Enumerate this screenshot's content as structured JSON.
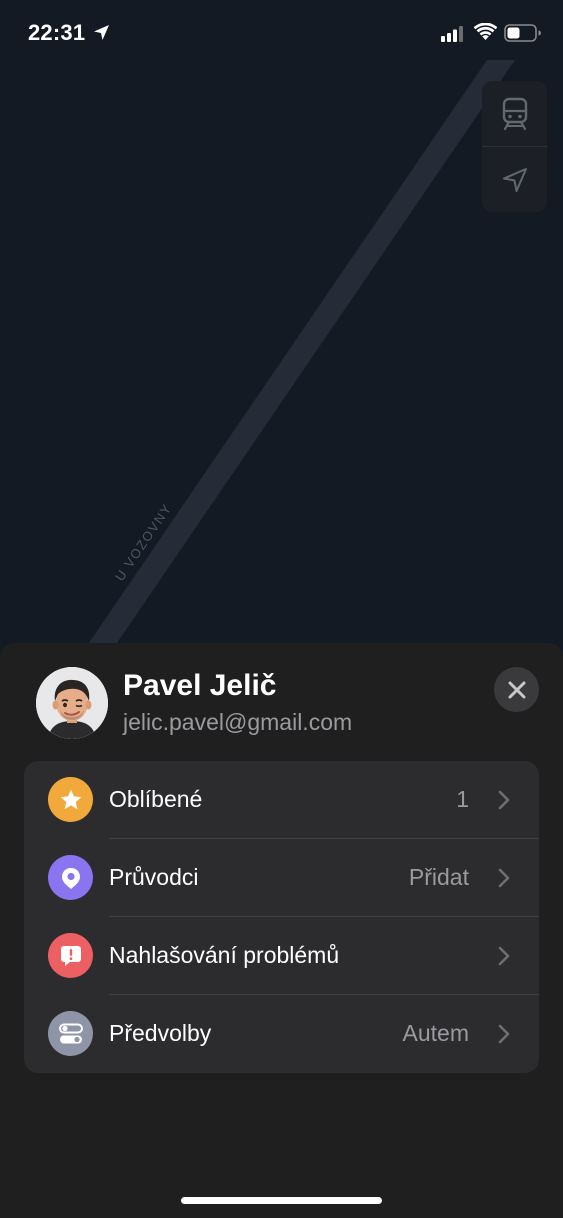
{
  "status_bar": {
    "time": "22:31"
  },
  "map": {
    "street_label": "U VOZOVNY"
  },
  "profile": {
    "name": "Pavel Jelič",
    "email": "jelic.pavel@gmail.com"
  },
  "menu": {
    "items": [
      {
        "label": "Oblíbené",
        "value": "1",
        "icon": "star-icon",
        "color": "#f2a93b"
      },
      {
        "label": "Průvodci",
        "value": "Přidat",
        "icon": "guides-icon",
        "color": "#8a74f0"
      },
      {
        "label": "Nahlašování problémů",
        "value": "",
        "icon": "report-icon",
        "color": "#ec5f63"
      },
      {
        "label": "Předvolby",
        "value": "Autem",
        "icon": "toggles-icon",
        "color": "#8e95a6"
      }
    ]
  }
}
